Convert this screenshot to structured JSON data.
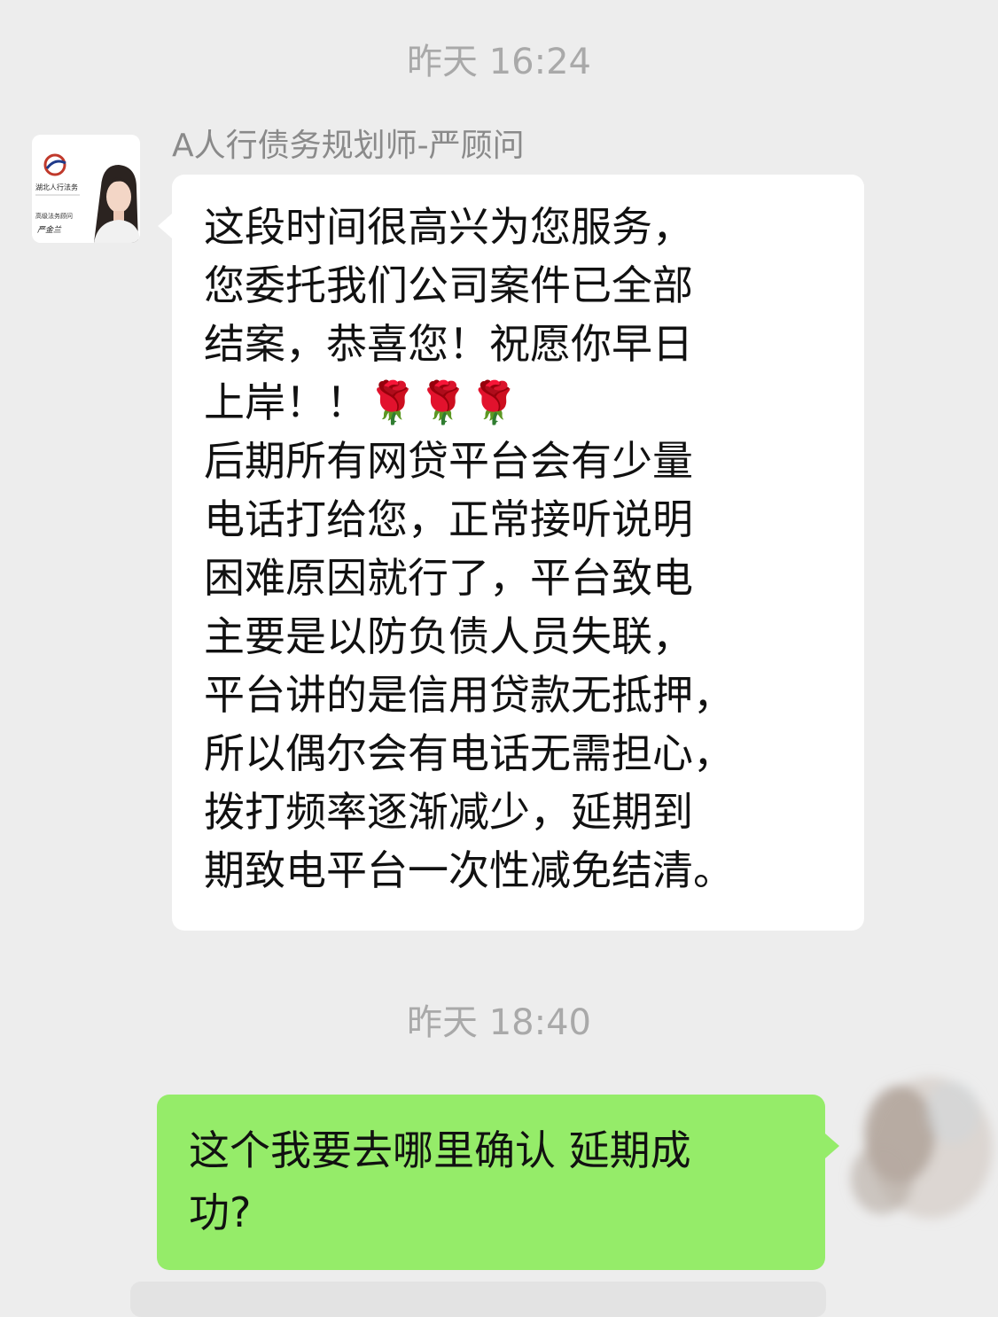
{
  "chat": {
    "time_1": "昨天 16:24",
    "sender_name": "A人行债务规划师-严顾问",
    "avatar": {
      "company": "湖北人行法务",
      "role": "高级法务顾问",
      "signature": "严金兰"
    },
    "incoming_message": "这段时间很高兴为您服务，\n您委托我们公司案件已全部\n结案，恭喜您！祝愿你早日\n上岸！！🌹🌹🌹\n后期所有网贷平台会有少量\n电话打给您，正常接听说明\n困难原因就行了，平台致电\n主要是以防负债人员失联，\n平台讲的是信用贷款无抵押，\n所以偶尔会有电话无需担心，\n拨打频率逐渐减少，延期到\n期致电平台一次性减免结清。",
    "time_2": "昨天 18:40",
    "outgoing_message": "这个我要去哪里确认 延期成\n功?"
  },
  "colors": {
    "background": "#ededed",
    "incoming_bubble": "#ffffff",
    "outgoing_bubble": "#95ec69",
    "timestamp": "#a9a9a9"
  }
}
